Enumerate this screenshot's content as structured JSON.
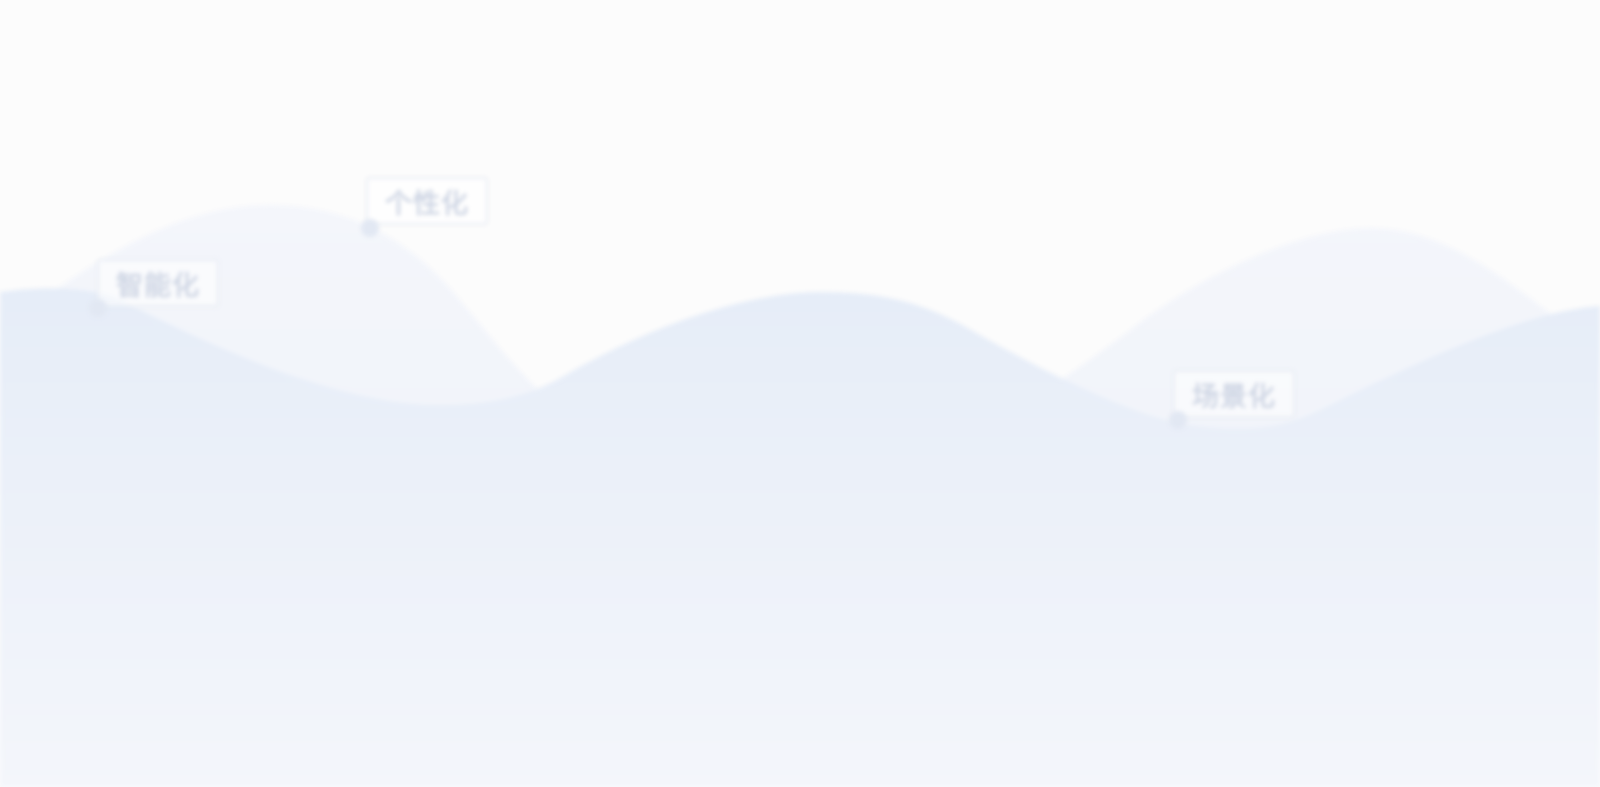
{
  "background": {
    "page_color": "#fcfcfc",
    "back_wave_color": "#f2f5fb",
    "front_wave_top_color": "#e6edf8",
    "front_wave_bottom_color": "#f4f6fb"
  },
  "tags": [
    {
      "label": "智能化"
    },
    {
      "label": "个性化"
    },
    {
      "label": "场景化"
    }
  ]
}
